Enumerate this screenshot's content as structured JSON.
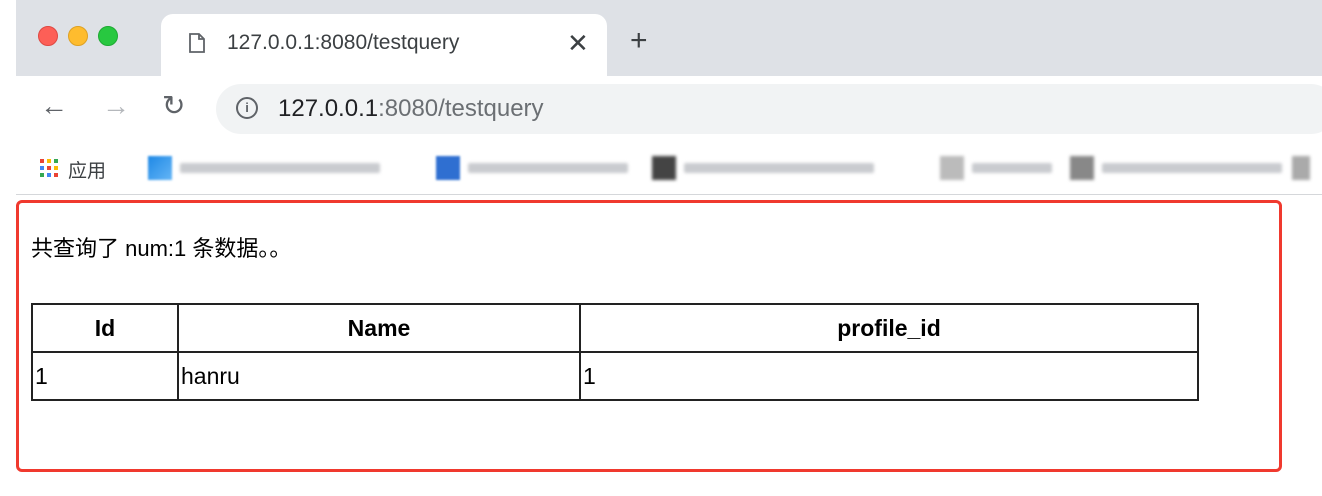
{
  "browser": {
    "tab": {
      "title": "127.0.0.1:8080/testquery",
      "close": "✕"
    },
    "new_tab": "+",
    "nav": {
      "back": "←",
      "forward": "→",
      "reload": "↻"
    },
    "address": {
      "host": "127.0.0.1",
      "path": ":8080/testquery"
    },
    "bookmarks": {
      "apps_label": "应用"
    }
  },
  "page": {
    "summary": "共查询了 num:1 条数据。。",
    "table": {
      "headers": [
        "Id",
        "Name",
        "profile_id"
      ],
      "rows": [
        [
          "1",
          "hanru",
          "1"
        ]
      ]
    }
  },
  "colors": {
    "highlight_border": "#f0392e",
    "tabstrip": "#dee1e6"
  }
}
